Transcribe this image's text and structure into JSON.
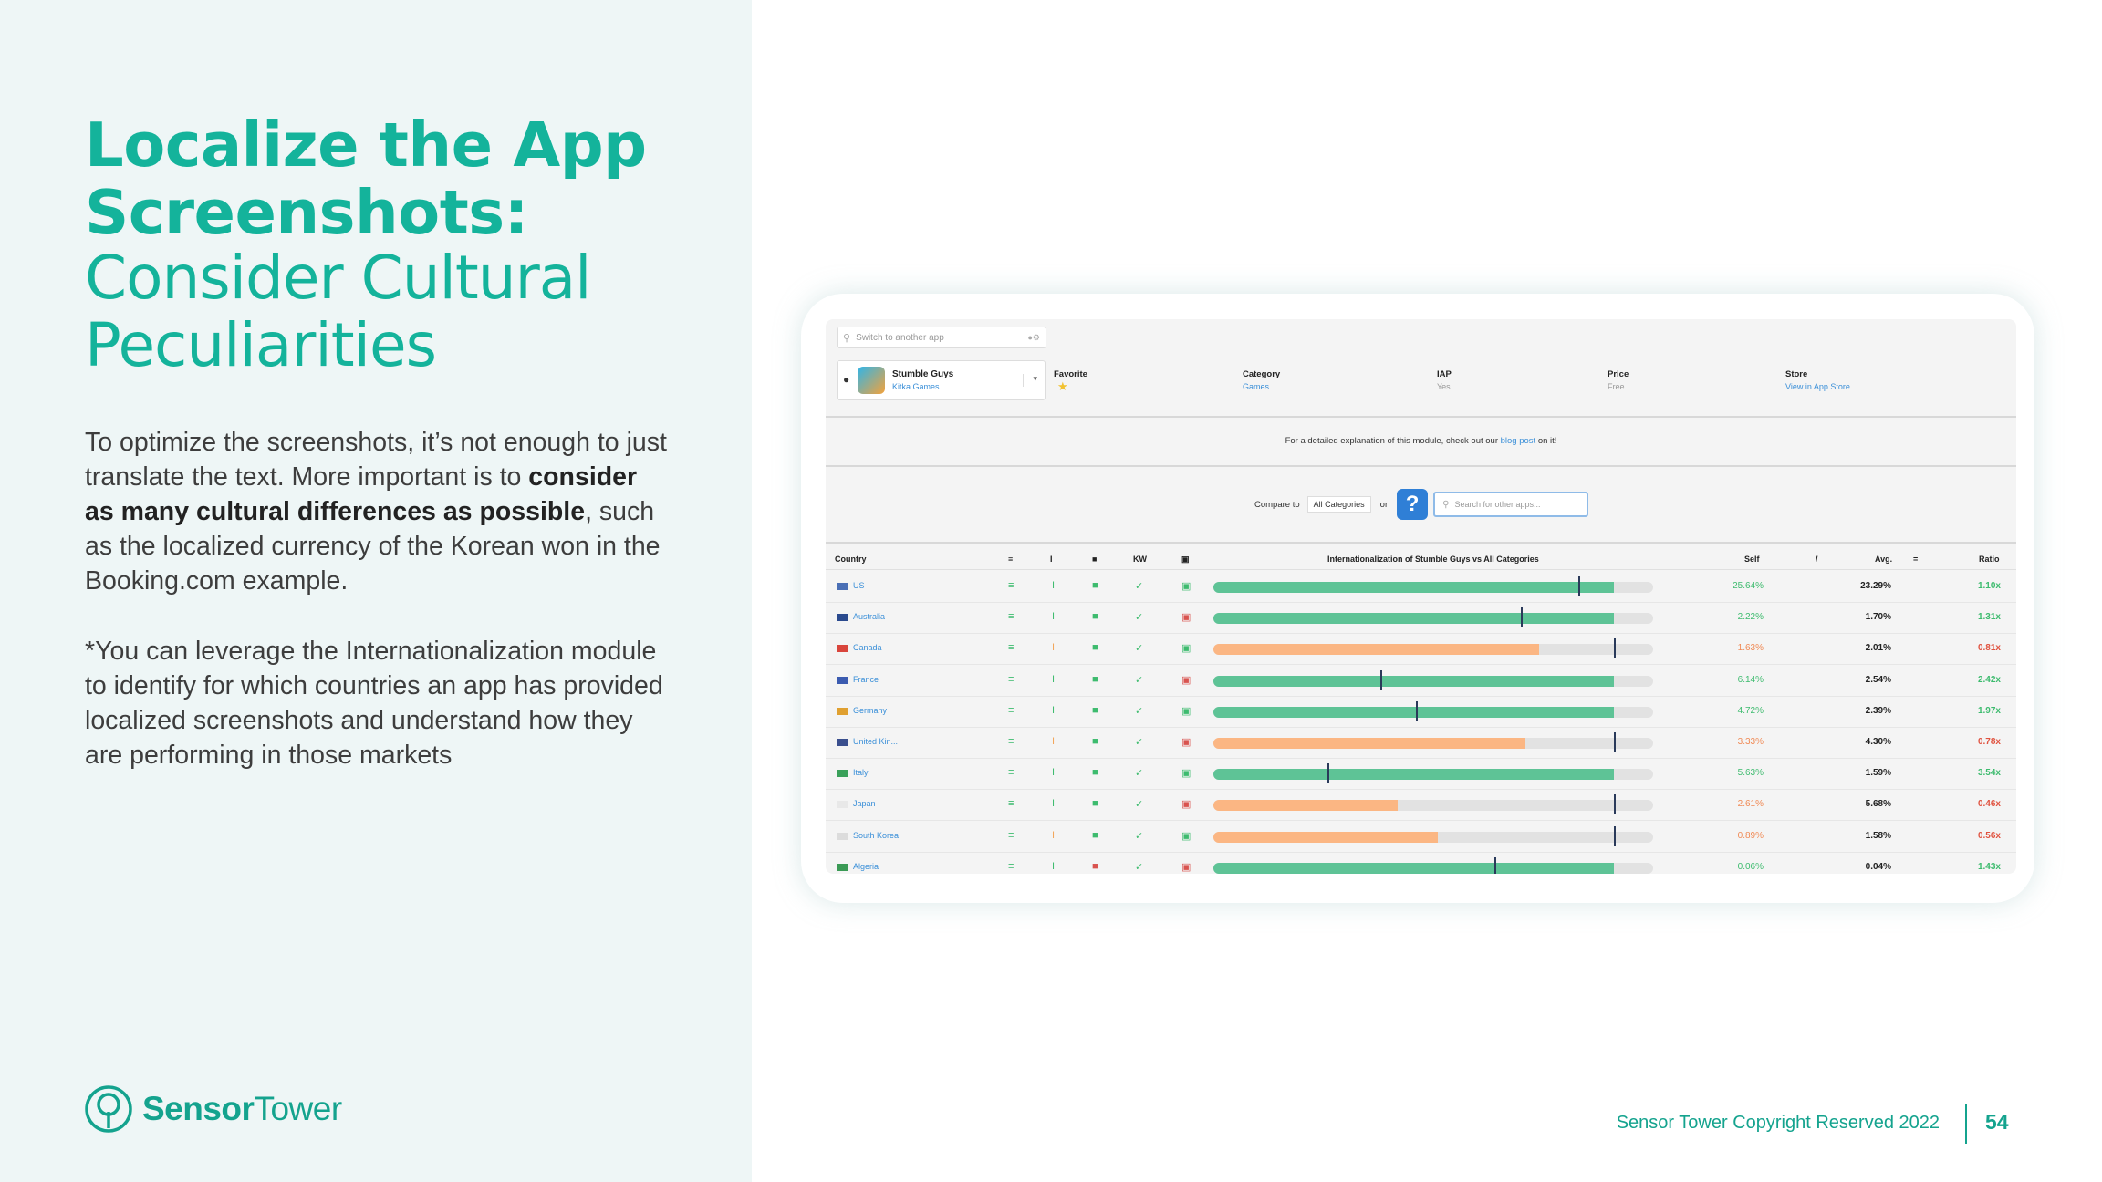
{
  "slide": {
    "title_bold": "Localize the App Screenshots:",
    "title_light": "Consider Cultural Peculiarities",
    "para1_a": "To optimize the screenshots, it’s not enough to just translate the text. More important is to ",
    "para1_bold": "consider as many cultural differences as possible",
    "para1_b": ", such as the localized currency of the Korean won in the Booking.com example.",
    "para2": "*You can leverage the Internationalization module to identify for which countries an app has provided localized screenshots and understand how they are performing in those markets",
    "logo_text_a": "Sensor",
    "logo_text_b": "Tower",
    "footer": "Sensor Tower Copyright Reserved 2022",
    "page_number": "54"
  },
  "screenshot": {
    "switch_placeholder": "Switch to another app",
    "app_name": "Stumble Guys",
    "app_developer": "Kitka Games",
    "meta": [
      {
        "label": "Favorite",
        "value": ""
      },
      {
        "label": "Category",
        "value": "Games"
      },
      {
        "label": "IAP",
        "value": "Yes"
      },
      {
        "label": "Price",
        "value": "Free"
      },
      {
        "label": "Store",
        "value": "View in App Store"
      }
    ],
    "blog_text": "For a detailed explanation of this module, check out our",
    "blog_link": "blog post",
    "blog_tail": "on it!",
    "compare_label": "Compare to",
    "compare_select": "All Categories",
    "or_label": "or",
    "search_placeholder": "Search for other apps...",
    "columns": {
      "country": "Country",
      "kw": "KW",
      "intl": "Internationalization of Stumble Guys vs All Categories",
      "self": "Self",
      "div": "/",
      "avg": "Avg.",
      "eq": "=",
      "ratio": "Ratio"
    },
    "rows": [
      {
        "country": "US",
        "self": "25.64%",
        "avg": "23.29%",
        "ratio": "1.10x",
        "status": "green",
        "fill": 0.91,
        "marker": 0.83,
        "flag": "#4a6fb5"
      },
      {
        "country": "Australia",
        "self": "2.22%",
        "avg": "1.70%",
        "ratio": "1.31x",
        "status": "green",
        "fill": 0.91,
        "marker": 0.7,
        "flag": "#2a4a8e"
      },
      {
        "country": "Canada",
        "self": "1.63%",
        "avg": "2.01%",
        "ratio": "0.81x",
        "status": "orange",
        "fill": 0.74,
        "marker": 0.91,
        "flag": "#d9453c"
      },
      {
        "country": "France",
        "self": "6.14%",
        "avg": "2.54%",
        "ratio": "2.42x",
        "status": "green",
        "fill": 0.91,
        "marker": 0.38,
        "flag": "#3b5bb0"
      },
      {
        "country": "Germany",
        "self": "4.72%",
        "avg": "2.39%",
        "ratio": "1.97x",
        "status": "green",
        "fill": 0.91,
        "marker": 0.46,
        "flag": "#e0a030"
      },
      {
        "country": "United Kin...",
        "self": "3.33%",
        "avg": "4.30%",
        "ratio": "0.78x",
        "status": "orange",
        "fill": 0.71,
        "marker": 0.91,
        "flag": "#3a4f8e"
      },
      {
        "country": "Italy",
        "self": "5.63%",
        "avg": "1.59%",
        "ratio": "3.54x",
        "status": "green",
        "fill": 0.91,
        "marker": 0.26,
        "flag": "#3aa05a"
      },
      {
        "country": "Japan",
        "self": "2.61%",
        "avg": "5.68%",
        "ratio": "0.46x",
        "status": "orange",
        "fill": 0.42,
        "marker": 0.91,
        "flag": "#e8e8e8"
      },
      {
        "country": "South Korea",
        "self": "0.89%",
        "avg": "1.58%",
        "ratio": "0.56x",
        "status": "orange",
        "fill": 0.51,
        "marker": 0.91,
        "flag": "#dcdcdc"
      },
      {
        "country": "Algeria",
        "self": "0.06%",
        "avg": "0.04%",
        "ratio": "1.43x",
        "status": "green",
        "fill": 0.91,
        "marker": 0.64,
        "flag": "#3a9a55"
      }
    ]
  },
  "colors": {
    "accent": "#14b39b",
    "green_bar": "#5ec396",
    "orange_bar": "#fbb683",
    "green_text": "#3dbb6e",
    "orange_text": "#f08a55",
    "red_text": "#e0523f"
  }
}
